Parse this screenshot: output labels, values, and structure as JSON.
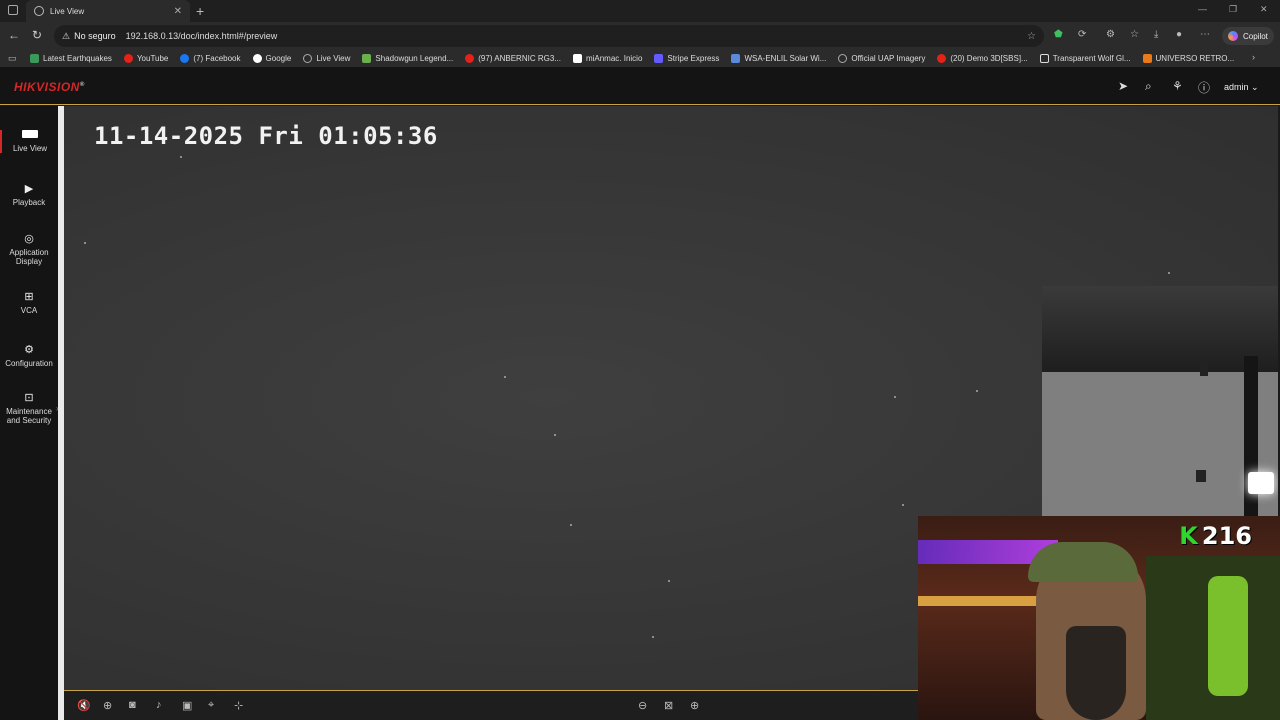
{
  "browser": {
    "tab_title": "Live View",
    "new_tab": "+",
    "security_label": "No seguro",
    "url": "192.168.0.13/doc/index.html#/preview",
    "copilot_label": "Copilot"
  },
  "bookmarks": [
    {
      "label": "Latest Earthquakes",
      "color": "#3a9a5a"
    },
    {
      "label": "YouTube",
      "color": "#e62117"
    },
    {
      "label": "(7) Facebook",
      "color": "#1877f2"
    },
    {
      "label": "Google",
      "color": "#ffffff"
    },
    {
      "label": "Live View",
      "color": "#aaaaaa"
    },
    {
      "label": "Shadowgun Legend...",
      "color": "#6ab04c"
    },
    {
      "label": "(97) ANBERNIC RG3...",
      "color": "#e62117"
    },
    {
      "label": "miAnmac. Inicio",
      "color": "#ffffff"
    },
    {
      "label": "Stripe Express",
      "color": "#635bff"
    },
    {
      "label": "WSA-ENLIL Solar Wi...",
      "color": "#5a8ad8"
    },
    {
      "label": "Official UAP Imagery",
      "color": "#aaaaaa"
    },
    {
      "label": "(20) Demo 3D[SBS]...",
      "color": "#e62117"
    },
    {
      "label": "Transparent Wolf Gl...",
      "color": "#dddddd"
    },
    {
      "label": "UNIVERSO RETRO...",
      "color": "#e87a1a"
    }
  ],
  "app": {
    "logo": "HIKVISION",
    "logo_mark": "®",
    "user": "admin",
    "accent_color": "#c8a248",
    "brand_color": "#d42727"
  },
  "nav": {
    "live_view": "Live View",
    "playback": "Playback",
    "application_display_1": "Application",
    "application_display_2": "Display",
    "vca": "VCA",
    "configuration": "Configuration",
    "maintenance_1": "Maintenance",
    "maintenance_2": "and Security"
  },
  "video": {
    "osd_timestamp": "11-14-2025 Fri 01:05:36"
  },
  "overlay": {
    "k_label": "K",
    "count": "216"
  }
}
